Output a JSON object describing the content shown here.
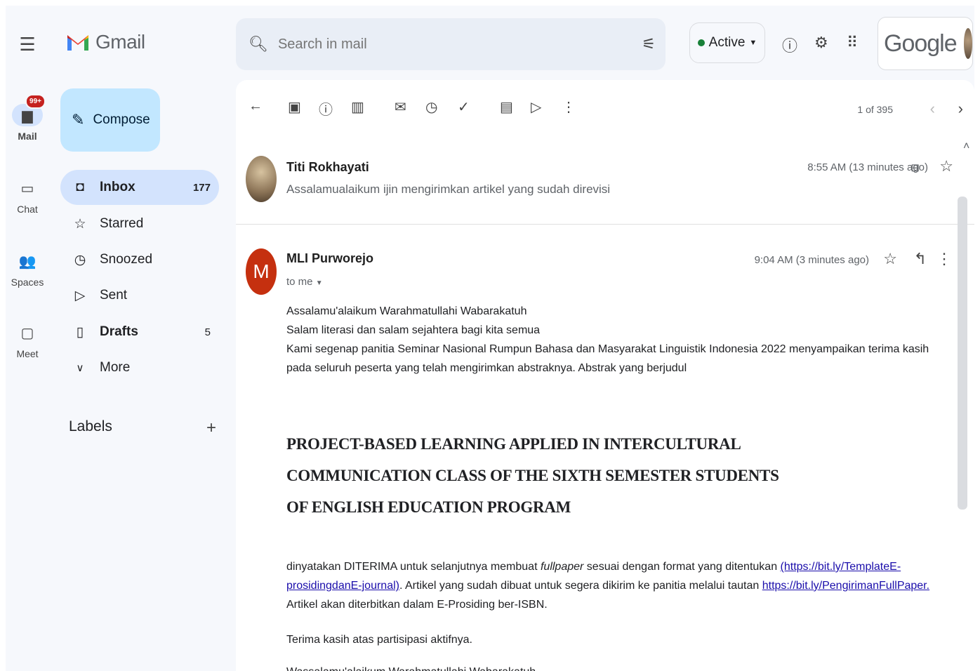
{
  "app": {
    "logo_text": "Gmail"
  },
  "rail": [
    {
      "label": "Mail",
      "icon": "mail-icon",
      "badge": "99+"
    },
    {
      "label": "Chat",
      "icon": "chat-icon"
    },
    {
      "label": "Spaces",
      "icon": "spaces-icon"
    },
    {
      "label": "Meet",
      "icon": "meet-icon"
    }
  ],
  "compose": {
    "label": "Compose"
  },
  "nav": [
    {
      "label": "Inbox",
      "count": "177",
      "icon": "inbox-icon"
    },
    {
      "label": "Starred",
      "count": "",
      "icon": "star-icon"
    },
    {
      "label": "Snoozed",
      "count": "",
      "icon": "clock-icon"
    },
    {
      "label": "Sent",
      "count": "",
      "icon": "send-icon"
    },
    {
      "label": "Drafts",
      "count": "5",
      "icon": "draft-icon"
    },
    {
      "label": "More",
      "count": "",
      "icon": "chevron-down-icon"
    }
  ],
  "labels": {
    "title": "Labels",
    "add": "+"
  },
  "search": {
    "placeholder": "Search in mail"
  },
  "status": {
    "label": "Active"
  },
  "account": {
    "brand": "Google"
  },
  "pager": {
    "text": "1 of 395"
  },
  "thread": {
    "msg1": {
      "sender": "Titi Rokhayati",
      "snippet": "Assalamualaikum ijin mengirimkan artikel yang sudah direvisi",
      "time": "8:55 AM (13 minutes ago)"
    },
    "msg2": {
      "avatar_letter": "M",
      "sender": "MLI Purworejo",
      "to": "to me",
      "time": "9:04 AM (3 minutes ago)",
      "lines": [
        "Assalamu'alaikum Warahmatullahi Wabarakatuh",
        "Salam literasi dan salam sejahtera bagi kita semua",
        "Kami segenap panitia Seminar Nasional Rumpun Bahasa dan Masyarakat Linguistik Indonesia 2022 menyampaikan terima kasih pada seluruh peserta yang telah mengirimkan abstraknya. Abstrak yang berjudul"
      ],
      "headline": [
        "PROJECT-BASED LEARNING APPLIED IN INTERCULTURAL",
        "COMMUNICATION CLASS OF THE SIXTH SEMESTER STUDENTS",
        "OF ENGLISH EDUCATION PROGRAM"
      ],
      "para2_a": "dinyatakan DITERIMA untuk selanjutnya membuat ",
      "para2_em": "fullpaper",
      "para2_b": " sesuai dengan format yang ditentukan ",
      "link1": "(https://bit.ly/TemplateE-prosidingdanE-journal)",
      "para2_c": ". Artikel yang sudah dibuat untuk segera dikirim ke panitia melalui tautan ",
      "link2": "https://bit.ly/PengirimanFullPaper.",
      "para2_d": " Artikel akan diterbitkan dalam E-Prosiding ber-ISBN.",
      "thanks": "Terima kasih atas partisipasi aktifnya.",
      "closing": "Wassalamu'alaikum Warahmatullahi Wabarakatuh"
    }
  }
}
